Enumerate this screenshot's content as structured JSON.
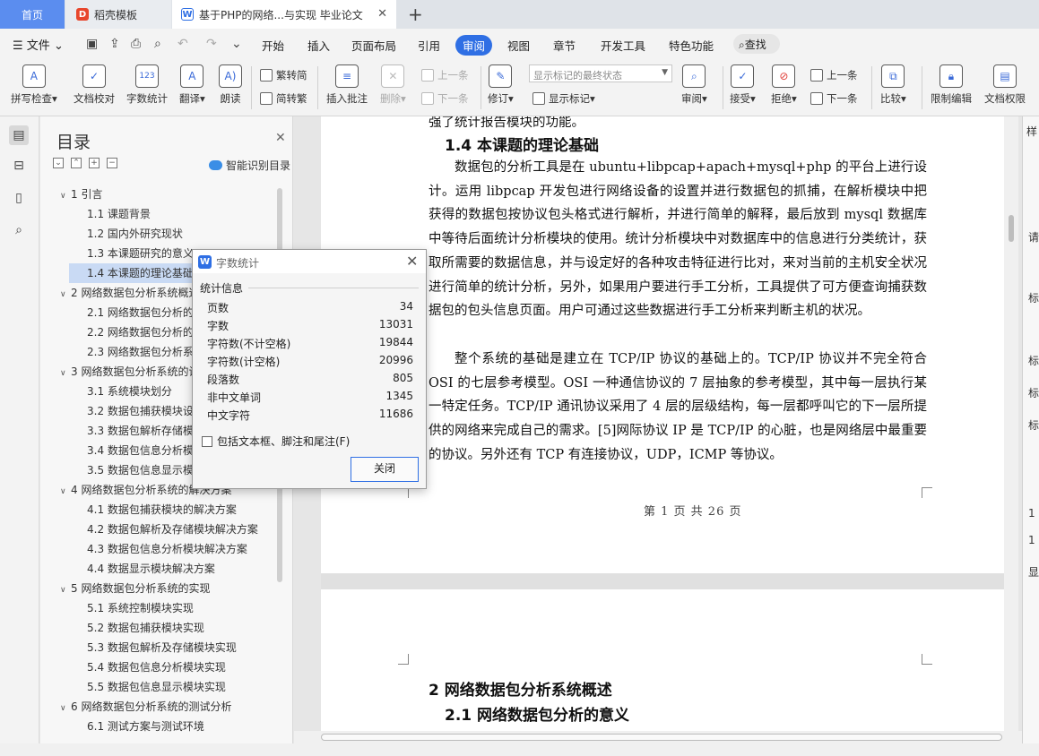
{
  "tabs": [
    {
      "label": "首页"
    },
    {
      "label": "稻壳模板"
    },
    {
      "label": "基于PHP的网络...与实现 毕业论文"
    }
  ],
  "menu": {
    "file": "文件",
    "items": [
      "开始",
      "插入",
      "页面布局",
      "引用",
      "审阅",
      "视图",
      "章节",
      "开发工具",
      "特色功能"
    ],
    "active": "审阅",
    "search": "查找"
  },
  "ribbon": {
    "spell": "拼写检查",
    "proof": "文档校对",
    "wordcount": "字数统计",
    "translate": "翻译",
    "read": "朗读",
    "trad": "繁转简",
    "simp": "简转繁",
    "insert_comment": "插入批注",
    "delete": "删除",
    "prev": "上一条",
    "next": "下一条",
    "track": "修订",
    "markup_state": "显示标记的最终状态",
    "show_markup": "显示标记",
    "review": "审阅",
    "accept": "接受",
    "reject": "拒绝",
    "prev2": "上一条",
    "next2": "下一条",
    "compare": "比较",
    "restrict": "限制编辑",
    "permission": "文档权限",
    "wordcount_icon_text": "123"
  },
  "toc": {
    "title": "目录",
    "smart": "智能识别目录",
    "items": [
      {
        "label": "1 引言",
        "level": 1
      },
      {
        "label": "1.1 课题背景",
        "level": 2
      },
      {
        "label": "1.2 国内外研究现状",
        "level": 2
      },
      {
        "label": "1.3 本课题研究的意义",
        "level": 2
      },
      {
        "label": "1.4 本课题的理论基础",
        "level": 2,
        "selected": true
      },
      {
        "label": "2 网络数据包分析系统概述",
        "level": 1
      },
      {
        "label": "2.1 网络数据包分析的意义",
        "level": 2
      },
      {
        "label": "2.2 网络数据包分析的原理",
        "level": 2
      },
      {
        "label": "2.3 网络数据包分析系统",
        "level": 2
      },
      {
        "label": "3 网络数据包分析系统的设计",
        "level": 1
      },
      {
        "label": "3.1 系统模块划分",
        "level": 2
      },
      {
        "label": "3.2 数据包捕获模块设计",
        "level": 2
      },
      {
        "label": "3.3 数据包解析存储模块设计",
        "level": 2
      },
      {
        "label": "3.4 数据包信息分析模块设计",
        "level": 2
      },
      {
        "label": "3.5 数据包信息显示模块设计",
        "level": 2
      },
      {
        "label": "4 网络数据包分析系统的解决方案",
        "level": 1
      },
      {
        "label": "4.1 数据包捕获模块的解决方案",
        "level": 2
      },
      {
        "label": "4.2 数据包解析及存储模块解决方案",
        "level": 2
      },
      {
        "label": "4.3 数据包信息分析模块解决方案",
        "level": 2
      },
      {
        "label": "4.4 数据显示模块解决方案",
        "level": 2
      },
      {
        "label": "5 网络数据包分析系统的实现",
        "level": 1
      },
      {
        "label": "5.1 系统控制模块实现",
        "level": 2
      },
      {
        "label": "5.2 数据包捕获模块实现",
        "level": 2
      },
      {
        "label": "5.3 数据包解析及存储模块实现",
        "level": 2
      },
      {
        "label": "5.4 数据包信息分析模块实现",
        "level": 2
      },
      {
        "label": "5.5 数据包信息显示模块实现",
        "level": 2
      },
      {
        "label": "6 网络数据包分析系统的测试分析",
        "level": 1
      },
      {
        "label": "6.1 测试方案与测试环境",
        "level": 2
      }
    ]
  },
  "doc": {
    "top_fragment": "强了统计报告模块的功能。",
    "h14": "1.4  本课题的理论基础",
    "para1": "数据包的分析工具是在 ubuntu+libpcap+apach+mysql+php 的平台上进行设计。运用 libpcap 开发包进行网络设备的设置并进行数据包的抓捕，在解析模块中把获得的数据包按协议包头格式进行解析，并进行简单的解释，最后放到 mysql 数据库中等待后面统计分析模块的使用。统计分析模块中对数据库中的信息进行分类统计，获取所需要的数据信息，并与设定好的各种攻击特征进行比对，来对当前的主机安全状况进行简单的统计分析，另外，如果用户要进行手工分析，工具提供了可方便查询捕获数据包的包头信息页面。用户可通过这些数据进行手工分析来判断主机的状况。",
    "para2": "整个系统的基础是建立在 TCP/IP 协议的基础上的。TCP/IP 协议并不完全符合 OSI 的七层参考模型。OSI 一种通信协议的 7 层抽象的参考模型，其中每一层执行某一特定任务。TCP/IP 通讯协议采用了 4 层的层级结构，每一层都呼叫它的下一层所提供的网络来完成自己的需求。[5]网际协议 IP 是 TCP/IP 的心脏，也是网络层中最重要的协议。另外还有 TCP 有连接协议，UDP，ICMP 等协议。",
    "footer": "第 1 页 共 26 页",
    "h2": "2  网络数据包分析系统概述",
    "h21": "2.1  网络数据包分析的意义"
  },
  "dialog": {
    "title": "字数统计",
    "section": "统计信息",
    "rows": [
      {
        "k": "页数",
        "v": "34"
      },
      {
        "k": "字数",
        "v": "13031"
      },
      {
        "k": "字符数(不计空格)",
        "v": "19844"
      },
      {
        "k": "字符数(计空格)",
        "v": "20996"
      },
      {
        "k": "段落数",
        "v": "805"
      },
      {
        "k": "非中文单词",
        "v": "1345"
      },
      {
        "k": "中文字符",
        "v": "11686"
      }
    ],
    "checkbox": "包括文本框、脚注和尾注(F)",
    "close": "关闭"
  },
  "right": {
    "lines": [
      "样",
      "请",
      "标",
      "标",
      "标",
      "标",
      "1",
      "1",
      "显"
    ]
  }
}
